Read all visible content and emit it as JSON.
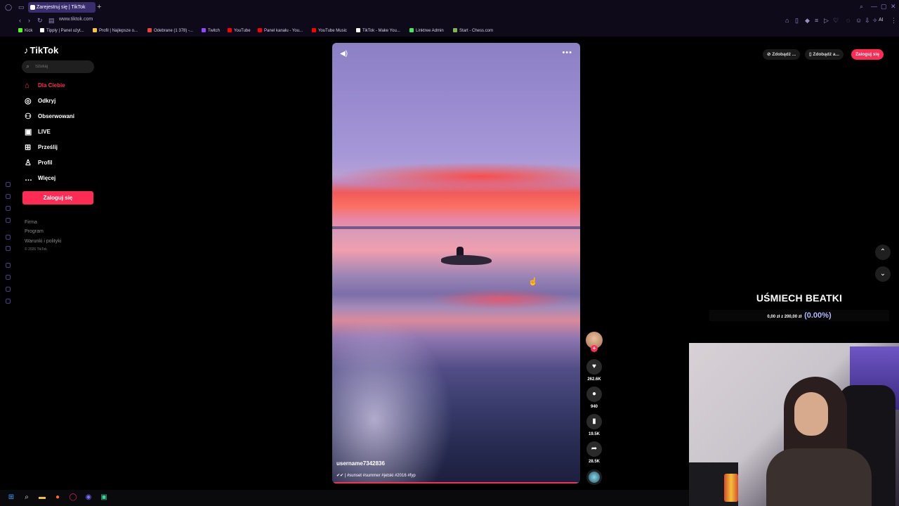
{
  "browser": {
    "tab_title": "Zarejestruj się | TikTok",
    "url": "www.tiktok.com",
    "bookmarks": [
      {
        "label": "Kick",
        "color": "#53fc18"
      },
      {
        "label": "Tipply | Panel użyt...",
        "color": "#ffffff"
      },
      {
        "label": "Profil | Najlepsze o...",
        "color": "#f5c542"
      },
      {
        "label": "Odebrane (1 378) -...",
        "color": "#ea4335"
      },
      {
        "label": "Twitch",
        "color": "#9146ff"
      },
      {
        "label": "YouTube",
        "color": "#ff0000"
      },
      {
        "label": "Panel kanału - You...",
        "color": "#ff0000"
      },
      {
        "label": "YouTube Music",
        "color": "#ff0000"
      },
      {
        "label": "TikTok - Make You...",
        "color": "#ffffff"
      },
      {
        "label": "Linktree Admin",
        "color": "#43e660"
      },
      {
        "label": "Start - Chess.com",
        "color": "#81b64c"
      }
    ],
    "ai_label": "AI"
  },
  "sidebar": {
    "logo": "TikTok",
    "search_placeholder": "Szukaj",
    "nav": [
      {
        "label": "Dla Ciebie",
        "icon": "home-icon",
        "active": true
      },
      {
        "label": "Odkryj",
        "icon": "compass-icon",
        "active": false
      },
      {
        "label": "Obserwowani",
        "icon": "following-icon",
        "active": false
      },
      {
        "label": "LIVE",
        "icon": "live-icon",
        "active": false
      },
      {
        "label": "Prześlij",
        "icon": "upload-icon",
        "active": false
      },
      {
        "label": "Profil",
        "icon": "profile-icon",
        "active": false
      },
      {
        "label": "Więcej",
        "icon": "more-icon",
        "active": false
      }
    ],
    "login_label": "Zaloguj się",
    "footer": [
      "Firma",
      "Program",
      "Warunki i polityki"
    ],
    "copyright": "© 2026 TikTok"
  },
  "video": {
    "author": "username7342836",
    "caption": "✔✔ | #sunset #summer #jetski #2016 #fyp",
    "progress": 0.99
  },
  "actions": {
    "likes": "262.6K",
    "comments": "940",
    "saves": "19.5K",
    "shares": "28.5K"
  },
  "topbar": {
    "get_coins": "Zdobądź ...",
    "get_app": "Zdobądź a...",
    "login": "Zaloguj się"
  },
  "overlay": {
    "goal_title": "UŚMIECH BEATKI",
    "goal_current": "0,00 zł",
    "goal_separator": "z",
    "goal_target": "200,00 zł",
    "goal_percent": "(0.00%)"
  },
  "colors": {
    "accent": "#fe2c55",
    "chrome_bg": "#0f0a19",
    "active_tab": "#3a2d6e"
  }
}
